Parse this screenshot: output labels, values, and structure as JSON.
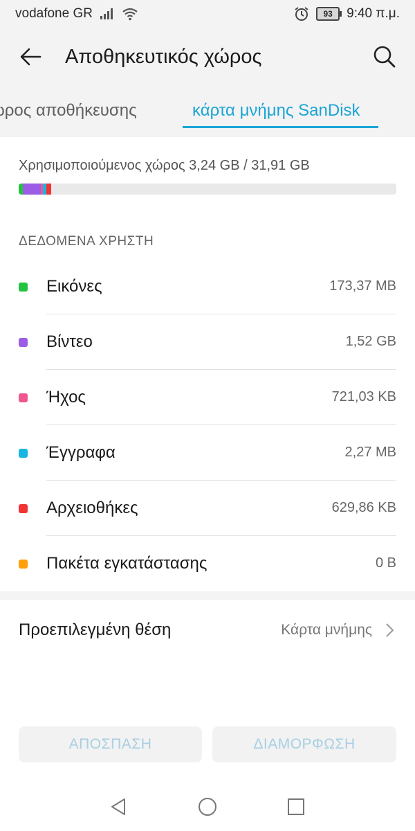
{
  "status_bar": {
    "carrier": "vodafone GR",
    "battery": "93",
    "time": "9:40 π.μ."
  },
  "app_bar": {
    "title": "Αποθηκευτικός χώρος"
  },
  "tabs": [
    {
      "label": "ώρος αποθήκευσης",
      "active": false
    },
    {
      "label": "κάρτα μνήμης SanDisk",
      "active": true
    }
  ],
  "storage": {
    "used_label": "Χρησιμοποιούμενος χώρος 3,24 GB / 31,91 GB",
    "used_fraction": 0.1,
    "section_title": "ΔΕΔΟΜΕΝΑ ΧΡΗΣΤΗ",
    "categories": [
      {
        "label": "Εικόνες",
        "value": "173,37 MB",
        "color": "#22c341"
      },
      {
        "label": "Βίντεο",
        "value": "1,52 GB",
        "color": "#9b5de5"
      },
      {
        "label": "Ήχος",
        "value": "721,03 KB",
        "color": "#f2568f"
      },
      {
        "label": "Έγγραφα",
        "value": "2,27 MB",
        "color": "#17b6e0"
      },
      {
        "label": "Αρχειοθήκες",
        "value": "629,86 KB",
        "color": "#f23333"
      },
      {
        "label": "Πακέτα εγκατάστασης",
        "value": "0 B",
        "color": "#ff9f0a"
      }
    ]
  },
  "default_location": {
    "label": "Προεπιλεγμένη θέση",
    "value": "Κάρτα μνήμης"
  },
  "buttons": {
    "eject": "ΑΠΟΣΠΑΣΗ",
    "format": "ΔΙΑΜΟΡΦΩΣΗ"
  },
  "colors": {
    "accent": "#1ba4d6",
    "button_text_disabled": "#a8cfe3"
  }
}
